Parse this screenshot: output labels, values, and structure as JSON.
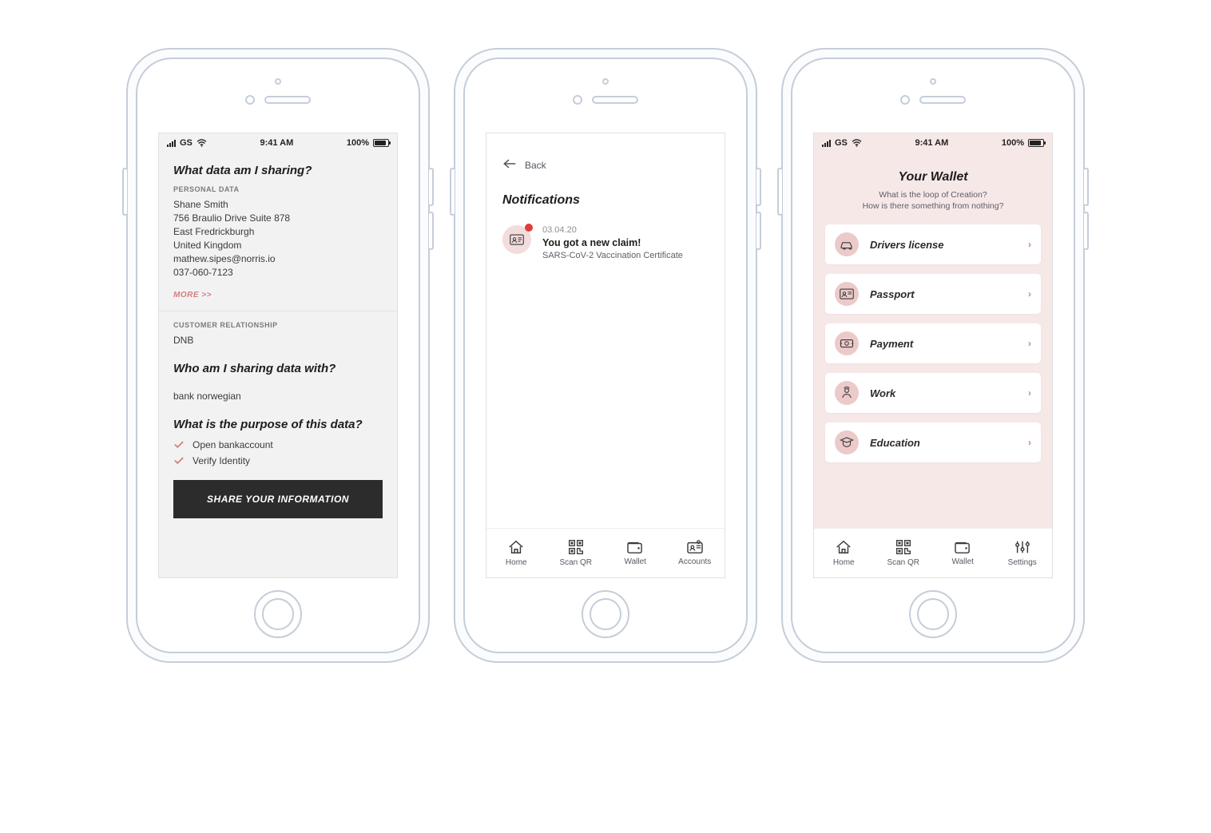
{
  "status": {
    "carrier": "GS",
    "time": "9:41 AM",
    "battery": "100%"
  },
  "screen1": {
    "q_what_sharing": "What data am I sharing?",
    "section_personal": "PERSONAL DATA",
    "name": "Shane Smith",
    "address1": "756 Braulio Drive Suite 878",
    "address2": "East Fredrickburgh",
    "country": "United Kingdom",
    "email": "mathew.sipes@norris.io",
    "phone": "037-060-7123",
    "more": "MORE >>",
    "section_relationship": "CUSTOMER RELATIONSHIP",
    "relationship": "DNB",
    "q_who": "Who am I sharing data with?",
    "who": "bank norwegian",
    "q_purpose": "What is the purpose of this data?",
    "purpose1": "Open bankaccount",
    "purpose2": "Verify Identity",
    "cta": "SHARE YOUR INFORMATION"
  },
  "screen2": {
    "back": "Back",
    "heading": "Notifications",
    "notif": {
      "date": "03.04.20",
      "title": "You got a new claim!",
      "subtitle": "SARS-CoV-2 Vaccination Certificate"
    },
    "tabs": {
      "home": "Home",
      "scan": "Scan QR",
      "wallet": "Wallet",
      "accounts": "Accounts"
    }
  },
  "screen3": {
    "heading": "Your Wallet",
    "sub1": "What is the loop of Creation?",
    "sub2": "How is there something from nothing?",
    "cards": {
      "drivers": "Drivers license",
      "passport": "Passport",
      "payment": "Payment",
      "work": "Work",
      "education": "Education"
    },
    "tabs": {
      "home": "Home",
      "scan": "Scan QR",
      "wallet": "Wallet",
      "settings": "Settings"
    }
  }
}
